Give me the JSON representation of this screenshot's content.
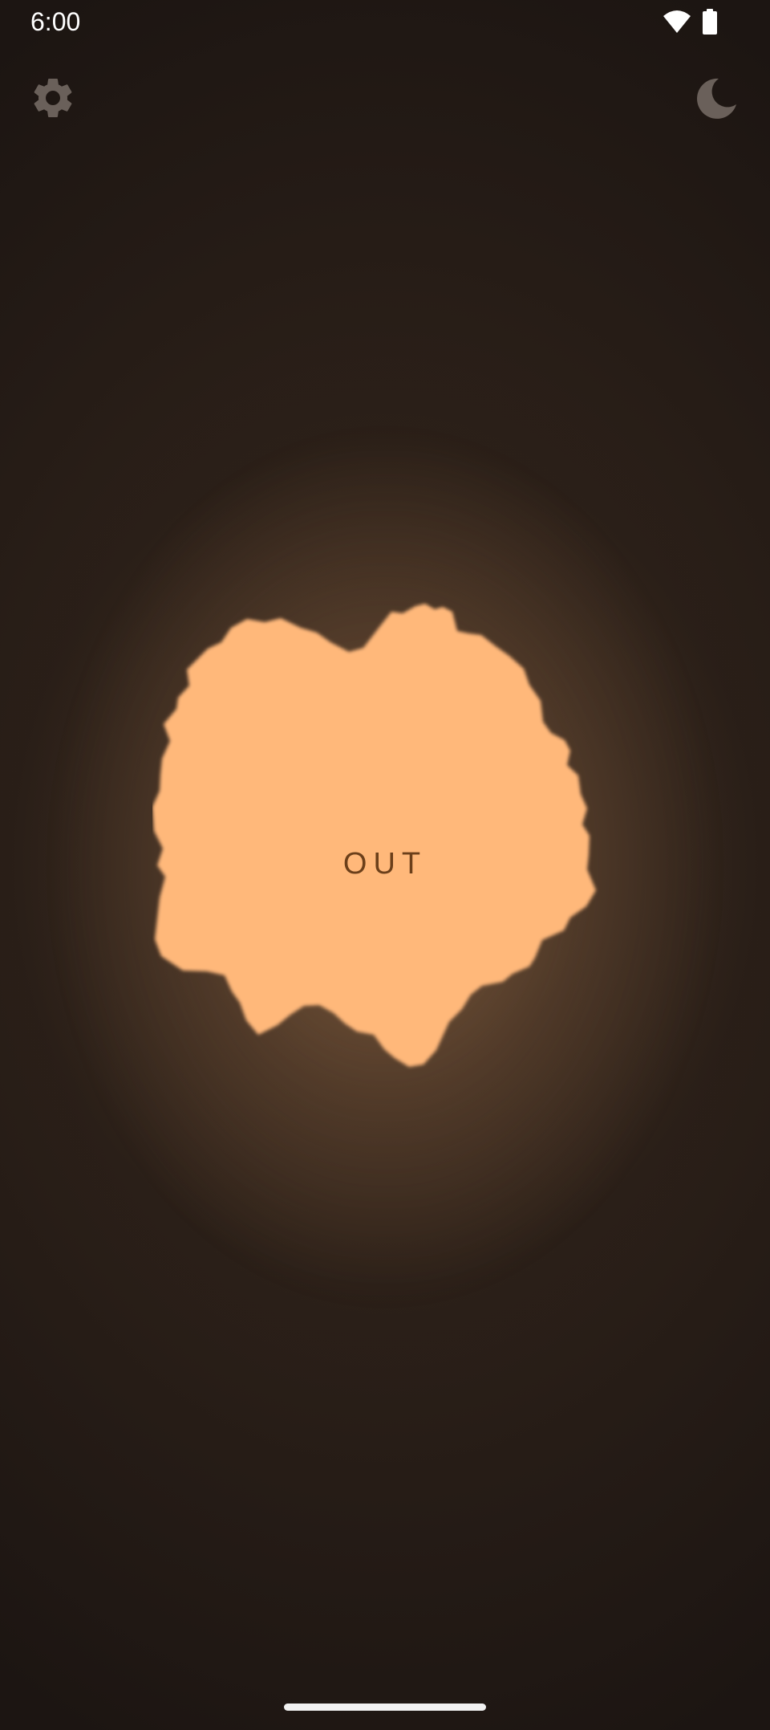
{
  "status_bar": {
    "time": "6:00",
    "icons": [
      "wifi-icon",
      "battery-icon"
    ]
  },
  "toolbar": {
    "left_icon": "gear-icon",
    "right_icon": "moon-icon"
  },
  "main": {
    "button_label": "OUT",
    "blob_color": "#ffb87a",
    "label_color": "#6b3f1a"
  },
  "colors": {
    "background": "#1b1411",
    "icon_gray": "#6a605a"
  }
}
